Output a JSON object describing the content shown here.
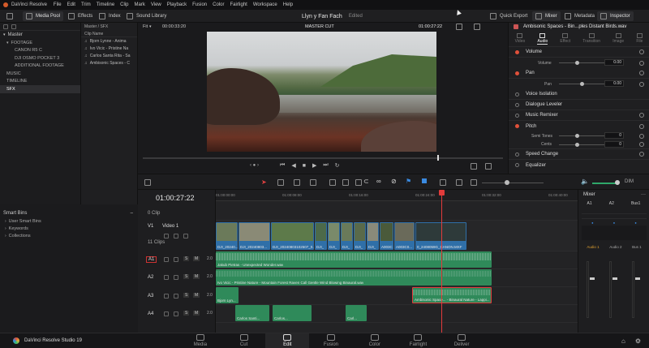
{
  "menubar": {
    "app": "DaVinci Resolve",
    "items": [
      "File",
      "Edit",
      "Trim",
      "Timeline",
      "Clip",
      "Mark",
      "View",
      "Playback",
      "Fusion",
      "Color",
      "Fairlight",
      "Workspace",
      "Help"
    ]
  },
  "toolbar": {
    "media_pool": "Media Pool",
    "effects": "Effects",
    "index": "Index",
    "sound_library": "Sound Library",
    "project_title": "Llyn y Fan Fach",
    "project_status": "Edited",
    "quick_export": "Quick Export",
    "mixer": "Mixer",
    "metadata": "Metadata",
    "inspector": "Inspector"
  },
  "viewer_bar": {
    "fit": "Fit",
    "timecode_left": "00:00:33:20",
    "timeline_name": "MASTER CUT",
    "timecode_right": "01:00:27:22"
  },
  "bins": {
    "master": "Master",
    "items": [
      "FOOTAGE",
      "CANON R5 C",
      "DJI OSMO POCKET 3",
      "ADDITIONAL FOOTAGE",
      "MUSIC",
      "TIMELINE",
      "SFX"
    ],
    "selected": "SFX",
    "smart_bins": "Smart Bins",
    "smart_items": [
      "User Smart Bins",
      "Keywords",
      "Collections"
    ]
  },
  "clip_list": {
    "path": "Master / SFX",
    "header": "Clip Name",
    "clips": [
      "Bjorn Lynne - Anima",
      "Ivo Vicic - Pristine Na",
      "Carlos Santa Rita - Sa",
      "Ambisonic Spaces - C"
    ]
  },
  "inspector": {
    "clip_title": "Ambisonic Spaces - Bin...ples Distant Birds.wav",
    "tabs": [
      "Video",
      "Audio",
      "Effect",
      "Transition",
      "Image",
      "File"
    ],
    "active_tab": "Audio",
    "sections": {
      "volume": "Volume",
      "volume_label": "Volume",
      "volume_value": "0.00",
      "pan": "Pan",
      "pan_label": "Pan",
      "pan_value": "0.00",
      "voice_isolation": "Voice Isolation",
      "dialogue_leveler": "Dialogue Leveler",
      "music_remixer": "Music Remixer",
      "pitch": "Pitch",
      "semitones": "Semi Tones",
      "semitones_value": "0",
      "cents": "Cents",
      "cents_value": "0",
      "speed_change": "Speed Change",
      "equalizer": "Equalizer"
    }
  },
  "timeline": {
    "timecode": "01:00:27:22",
    "ruler": [
      "01:00:00:00",
      "01:00:08:00",
      "01:00:16:00",
      "01:00:24:00",
      "01:00:32:00",
      "01:00:40:00"
    ],
    "v1_clip_count": "0 Clip",
    "v1_label": "V1",
    "v1_name": "Video 1",
    "v1_clips": "11 Clips",
    "v1_clip_labels": [
      "DJI_20240...",
      "DJI_20240803...",
      "DJI_20240803102507_0...",
      "DJI_",
      "DJI_",
      "DJI_",
      "DJI_",
      "DJI_",
      "A003C",
      "A003C0...",
      "0_2408059G_CANON.MXF"
    ],
    "a1_label": "A1",
    "a1_level": "2.0",
    "a1_clip": "Jakub Pietras - Unexpected Wonder.wav",
    "a2_label": "A2",
    "a2_level": "2.0",
    "a2_clip": "Ivo Vicic - Pristine Nature - Mountain Forest Raven Call Gentle Wind Blowing Binaural.wav",
    "a3_label": "A3",
    "a3_level": "2.0",
    "a3_clip_1": "Bjorn Lyn...",
    "a3_clip_2": "Ambisonic Space... - Binaural Nature - Lappi...",
    "a4_label": "A4",
    "a4_level": "2.0",
    "a4_clips": [
      "Carlos Santi...",
      "Carlos...",
      "Carl..."
    ]
  },
  "mixer": {
    "title": "Mixer",
    "channels": [
      "A1",
      "A2",
      "Bus1"
    ],
    "audio_labels": [
      "Audio 1",
      "Audio 2",
      "Bus 1"
    ]
  },
  "pages": {
    "items": [
      "Media",
      "Cut",
      "Edit",
      "Fusion",
      "Color",
      "Fairlight",
      "Deliver"
    ],
    "active": "Edit",
    "brand": "DaVinci Resolve Studio 19"
  },
  "colors": {
    "video_clip": "#2f6fa8",
    "audio_clip": "#2f8a5a",
    "playhead": "#e23b3b",
    "selection": "#e23b3b"
  }
}
